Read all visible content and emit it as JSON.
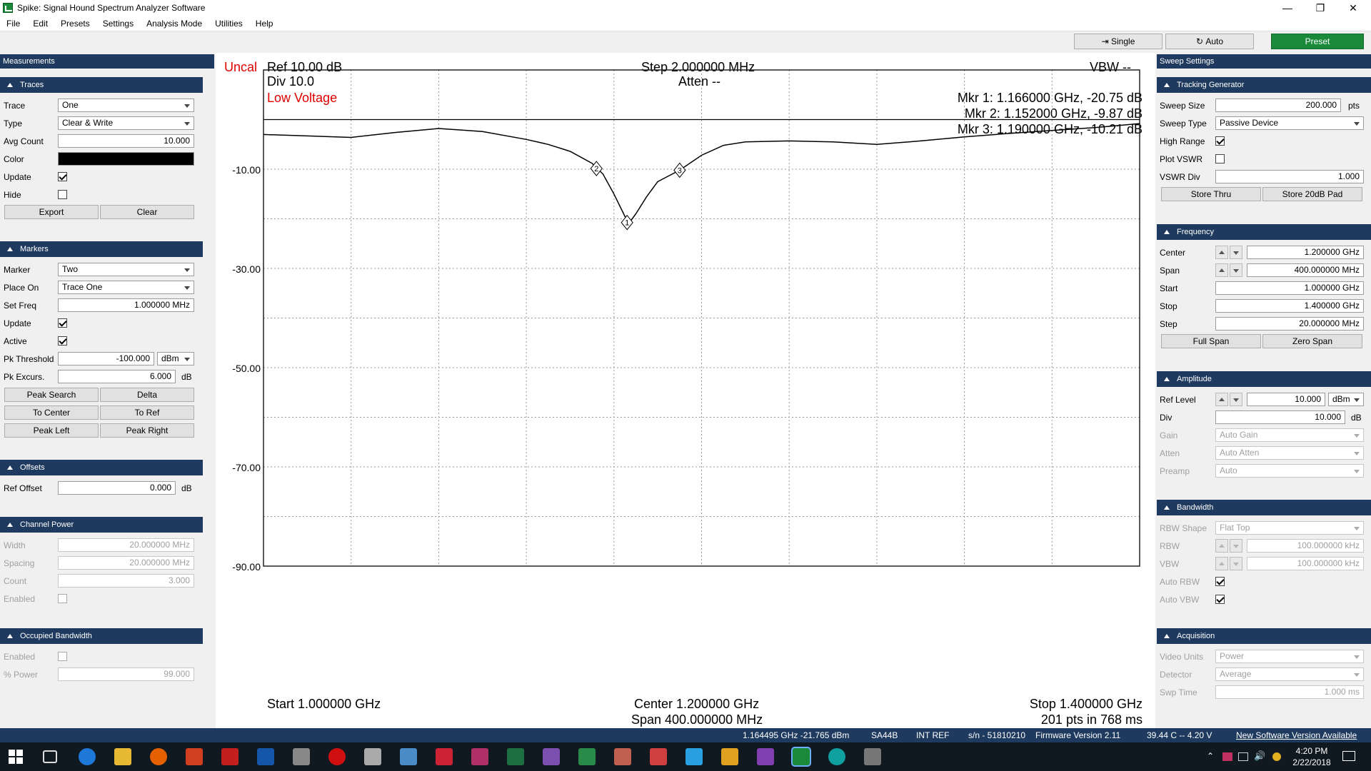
{
  "window": {
    "title": "Spike: Signal Hound Spectrum Analyzer Software"
  },
  "menu": [
    "File",
    "Edit",
    "Presets",
    "Settings",
    "Analysis Mode",
    "Utilities",
    "Help"
  ],
  "toolbar": {
    "single_label": "Single",
    "auto_label": "Auto",
    "preset_label": "Preset"
  },
  "left_panel": {
    "header": "Measurements",
    "traces": {
      "title": "Traces",
      "trace_label": "Trace",
      "trace_value": "One",
      "type_label": "Type",
      "type_value": "Clear & Write",
      "avg_label": "Avg Count",
      "avg_value": "10.000",
      "color_label": "Color",
      "color_value": "#000000",
      "update_label": "Update",
      "update_checked": true,
      "hide_label": "Hide",
      "hide_checked": false,
      "export_label": "Export",
      "clear_label": "Clear"
    },
    "markers": {
      "title": "Markers",
      "marker_label": "Marker",
      "marker_value": "Two",
      "place_label": "Place On",
      "place_value": "Trace One",
      "setfreq_label": "Set Freq",
      "setfreq_value": "1.000000 MHz",
      "update_label": "Update",
      "active_label": "Active",
      "pk_label": "Pk Threshold",
      "pk_value": "-100.000",
      "pk_unit": "dBm",
      "exc_label": "Pk Excurs.",
      "exc_value": "6.000",
      "exc_unit": "dB",
      "peak_search": "Peak Search",
      "delta": "Delta",
      "to_center": "To Center",
      "to_ref": "To Ref",
      "peak_left": "Peak Left",
      "peak_right": "Peak Right"
    },
    "offsets": {
      "title": "Offsets",
      "ref_label": "Ref Offset",
      "ref_value": "0.000",
      "ref_unit": "dB"
    },
    "channel_power": {
      "title": "Channel Power",
      "width_label": "Width",
      "width_value": "20.000000 MHz",
      "spacing_label": "Spacing",
      "spacing_value": "20.000000 MHz",
      "count_label": "Count",
      "count_value": "3.000",
      "enabled_label": "Enabled"
    },
    "occupied_bw": {
      "title": "Occupied Bandwidth",
      "enabled_label": "Enabled",
      "power_label": "% Power",
      "power_value": "99.000"
    }
  },
  "right_panel": {
    "header": "Sweep Settings",
    "tracking": {
      "title": "Tracking Generator",
      "size_label": "Sweep Size",
      "size_value": "200.000",
      "size_unit": "pts",
      "type_label": "Sweep Type",
      "type_value": "Passive Device",
      "high_label": "High Range",
      "vswr_label": "Plot VSWR",
      "div_label": "VSWR Div",
      "div_value": "1.000",
      "store_thru": "Store Thru",
      "store_pad": "Store 20dB Pad"
    },
    "frequency": {
      "title": "Frequency",
      "center_label": "Center",
      "center_value": "1.200000 GHz",
      "span_label": "Span",
      "span_value": "400.000000 MHz",
      "start_label": "Start",
      "start_value": "1.000000 GHz",
      "stop_label": "Stop",
      "stop_value": "1.400000 GHz",
      "step_label": "Step",
      "step_value": "20.000000 MHz",
      "full_span": "Full Span",
      "zero_span": "Zero Span"
    },
    "amplitude": {
      "title": "Amplitude",
      "ref_label": "Ref Level",
      "ref_value": "10.000",
      "ref_unit": "dBm",
      "div_label": "Div",
      "div_value": "10.000",
      "div_unit": "dB",
      "gain_label": "Gain",
      "gain_value": "Auto Gain",
      "atten_label": "Atten",
      "atten_value": "Auto Atten",
      "preamp_label": "Preamp",
      "preamp_value": "Auto"
    },
    "bandwidth": {
      "title": "Bandwidth",
      "shape_label": "RBW Shape",
      "shape_value": "Flat Top",
      "rbw_label": "RBW",
      "rbw_value": "100.000000 kHz",
      "vbw_label": "VBW",
      "vbw_value": "100.000000 kHz",
      "auto_rbw_label": "Auto RBW",
      "auto_vbw_label": "Auto VBW"
    },
    "acquisition": {
      "title": "Acquisition",
      "units_label": "Video Units",
      "units_value": "Power",
      "det_label": "Detector",
      "det_value": "Average",
      "swp_label": "Swp Time",
      "swp_value": "1.000 ms"
    }
  },
  "graph": {
    "uncal": "Uncal",
    "ref": "Ref 10.00 dB",
    "div": "Div 10.0",
    "step": "Step 2.000000 MHz",
    "atten": "Atten --",
    "vbw": "VBW --",
    "low_voltage": "Low Voltage",
    "mkr1": "Mkr 1: 1.166000 GHz, -20.75 dB",
    "mkr2": "Mkr 2: 1.152000 GHz, -9.87 dB",
    "mkr3": "Mkr 3: 1.190000 GHz, -10.21 dB",
    "start": "Start 1.000000 GHz",
    "center": "Center 1.200000 GHz",
    "span": "Span 400.000000 MHz",
    "stop": "Stop 1.400000 GHz",
    "pts": "201 pts in 768 ms",
    "y_ticks": [
      "-10.00",
      "-30.00",
      "-50.00",
      "-70.00",
      "-90.00"
    ],
    "marker_ids": [
      "1",
      "2",
      "3"
    ]
  },
  "chart_data": {
    "type": "line",
    "xlabel": "",
    "ylabel": "",
    "xlim": [
      1.0,
      1.4
    ],
    "ylim": [
      -90,
      10
    ],
    "reference_line": 0,
    "series": [
      {
        "x": [
          1.0,
          1.02,
          1.04,
          1.06,
          1.08,
          1.1,
          1.12,
          1.13,
          1.14,
          1.15,
          1.155,
          1.16,
          1.165,
          1.167,
          1.17,
          1.175,
          1.18,
          1.19,
          1.2,
          1.21,
          1.22,
          1.24,
          1.26,
          1.28,
          1.3,
          1.32,
          1.34,
          1.36,
          1.38,
          1.4
        ],
        "values": [
          -3.0,
          -3.3,
          -3.6,
          -2.6,
          -1.8,
          -2.4,
          -4.0,
          -5.0,
          -6.4,
          -8.8,
          -11.0,
          -15.0,
          -19.5,
          -20.8,
          -19.0,
          -15.5,
          -12.5,
          -10.2,
          -7.2,
          -5.2,
          -4.5,
          -4.3,
          -4.5,
          -5.0,
          -4.3,
          -3.5,
          -2.8,
          -2.2,
          -1.6,
          -0.8
        ]
      }
    ],
    "markers": [
      {
        "id": "1",
        "x": 1.166,
        "y": -20.75
      },
      {
        "id": "2",
        "x": 1.152,
        "y": -9.87
      },
      {
        "id": "3",
        "x": 1.19,
        "y": -10.21
      }
    ]
  },
  "status": {
    "readout": "1.164495 GHz -21.765 dBm",
    "device": "SA44B",
    "ref": "INT REF",
    "serial": "s/n - 51810210",
    "firmware": "Firmware Version 2.11",
    "temp": "39.44 C -- 4.20 V",
    "update": "New Software Version Available"
  },
  "taskbar": {
    "time": "4:20 PM",
    "date": "2/22/2018"
  }
}
